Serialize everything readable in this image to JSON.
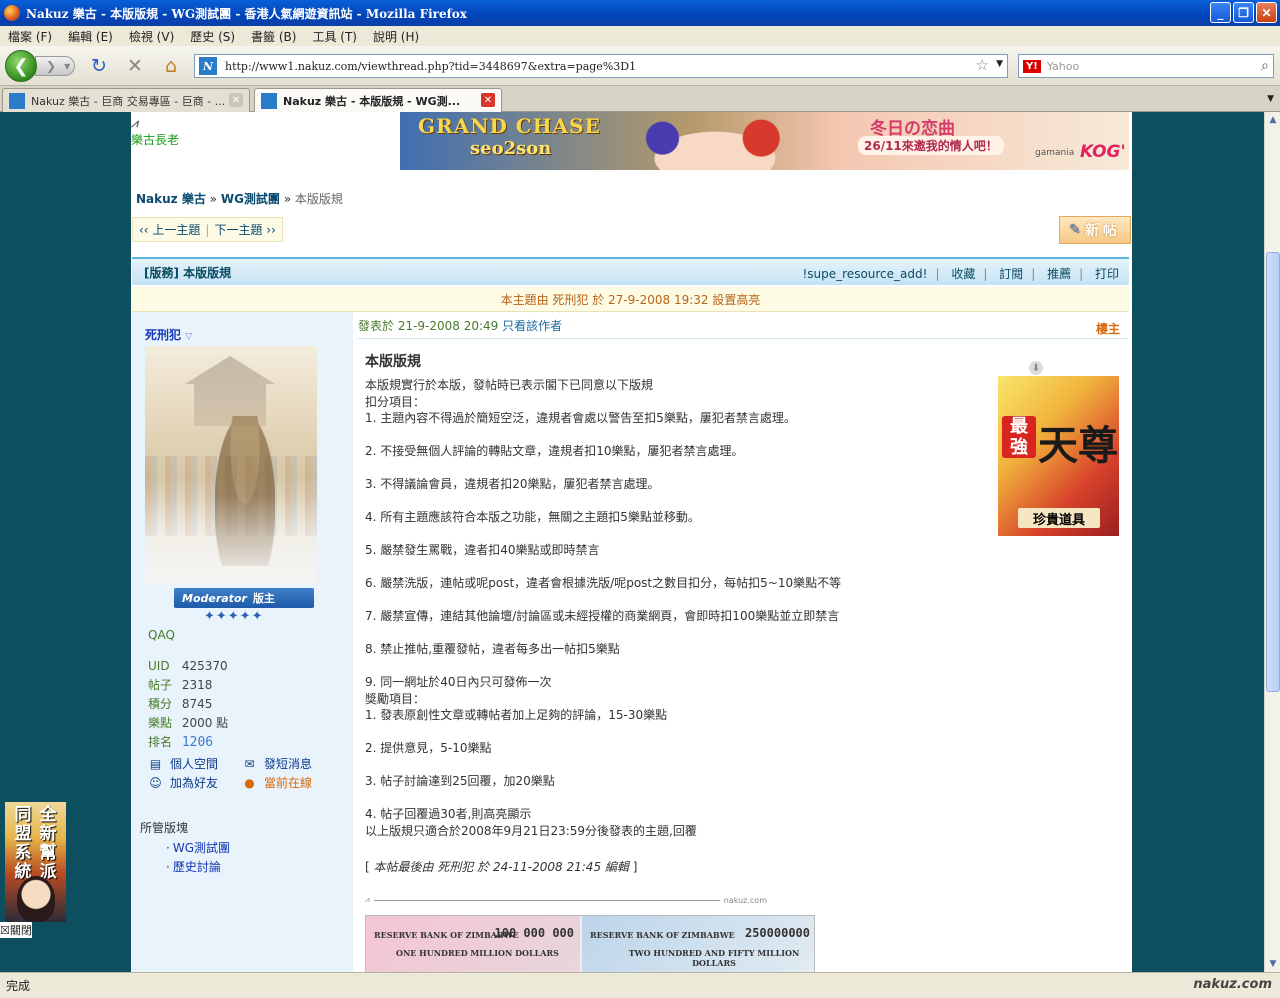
{
  "window": {
    "title": "Nakuz 樂古 - 本版版規 - WG測試團 - 香港人氣網遊資訊站 - Mozilla Firefox",
    "minimize": "_",
    "maximize": "❐",
    "close": "✕"
  },
  "menu": [
    "檔案 (F)",
    "編輯 (E)",
    "檢視 (V)",
    "歷史 (S)",
    "書籤 (B)",
    "工具 (T)",
    "說明 (H)"
  ],
  "nav": {
    "url": "http://www1.nakuz.com/viewthread.php?tid=3448697&extra=page%3D1",
    "search_placeholder": "Yahoo",
    "search_engine": "Y!"
  },
  "tabs": [
    {
      "label": "Nakuz 樂古 - 巨商 交易專區 - 巨商 - ...",
      "active": false
    },
    {
      "label": "Nakuz 樂古 - 本版版規 - WG測...",
      "active": true
    }
  ],
  "site": {
    "left_logo": "樂古長老",
    "banner_line1": "GRAND CHASE",
    "banner_line2": "seo2son",
    "banner_line3": "冬日の恋曲",
    "banner_line4": "26/11來邀我的情人吧！",
    "banner_brand1": "gamania",
    "banner_brand2": "KOG'"
  },
  "breadcrumb": {
    "home": "Nakuz 樂古",
    "sep": "»",
    "forum": "WG測試團",
    "current": "本版版規"
  },
  "prevnext": {
    "prev": "‹‹ 上一主題",
    "next": "下一主題 ››"
  },
  "newpost_label": "新帖",
  "thread": {
    "title": "[版務] 本版版規",
    "actions": [
      "!supe_resource_add!",
      "收藏",
      "訂閱",
      "推薦",
      "打印"
    ],
    "highlight_note": "本主題由 死刑犯 於 27-9-2008 19:32 設置高亮"
  },
  "author": {
    "name": "死刑犯",
    "badge": "Moderator 版主",
    "badge_en": "Moderator",
    "badge_zh": "版主",
    "stars": "✦✦✦✦✦",
    "alias": "QAQ",
    "stats": [
      {
        "label": "UID",
        "value": "425370"
      },
      {
        "label": "帖子",
        "value": "2318"
      },
      {
        "label": "積分",
        "value": "8745"
      },
      {
        "label": "樂點",
        "value": "2000 點"
      },
      {
        "label": "排名",
        "value": "1206"
      }
    ],
    "links": [
      {
        "label": "個人空間",
        "icon": "profile-icon"
      },
      {
        "label": "發短消息",
        "icon": "message-icon"
      },
      {
        "label": "加為好友",
        "icon": "add-friend-icon"
      },
      {
        "label": "當前在線",
        "icon": "online-icon"
      }
    ],
    "managed_title": "所管版塊",
    "managed": [
      "WG測試團",
      "歷史討論"
    ]
  },
  "post": {
    "meta_prefix": "發表於 21-9-2008 20:49",
    "meta_link": "只看該作者",
    "floor": "樓主",
    "title": "本版版規",
    "body": "本版規實行於本版，發帖時已表示閣下已同意以下版規\n扣分項目：\n1. 主題內容不得過於簡短空泛，違規者會處以警告至扣5樂點，屢犯者禁言處理。\n\n2. 不接受無個人評論的轉貼文章，違規者扣10樂點，屢犯者禁言處理。\n\n3. 不得議論會員，違規者扣20樂點，屢犯者禁言處理。\n\n4. 所有主題應該符合本版之功能，無關之主題扣5樂點並移動。\n\n5. 嚴禁發生罵戰，違者扣40樂點或即時禁言\n\n6. 嚴禁洗版，連帖或呢post，違者會根據洗版/呢post之數目扣分，每帖扣5~10樂點不等\n\n7. 嚴禁宣傳，連結其他論壇/討論區或未經授權的商業網頁，會即時扣100樂點並立即禁言\n\n8. 禁止推帖,重覆發帖，違者每多出一帖扣5樂點\n\n9. 同一網址於40日內只可發佈一次\n獎勵項目：\n1. 發表原創性文章或轉帖者加上足夠的評論，15-30樂點\n\n2. 提供意見，5-10樂點\n\n3. 帖子討論達到25回覆，加20樂點\n\n4. 帖子回覆過30者,則高亮顯示\n以上版規只適合於2008年9月21日23:59分後發表的主題,回覆",
    "edited": "本帖最後由 死刑犯 於 24-11-2008 21:45 編輯",
    "watermark": "nakuz.com",
    "bill1_bank": "RESERVE BANK OF ZIMBABWE",
    "bill1_amount": "100 000 000",
    "bill1_words": "ONE HUNDRED MILLION DOLLARS",
    "bill2_bank": "RESERVE BANK OF ZIMBABWE",
    "bill2_amount": "250000000",
    "bill2_words": "TWO HUNDRED AND FIFTY MILLION DOLLARS"
  },
  "side_ad": {
    "tag1": "最強",
    "big": "天尊",
    "tag2": "珍貴道具"
  },
  "float_ad": {
    "col1": "同盟系統",
    "col2": "全新幫派",
    "close": "關閉"
  },
  "status": {
    "text": "完成",
    "logo": "nakuz.com"
  },
  "colors": {
    "page_bg": "#1c4e5e",
    "title_bar": "#0a5fd8",
    "link": "#0a4a6e",
    "highlight": "#b86318",
    "author_label": "#4a7a2a"
  }
}
